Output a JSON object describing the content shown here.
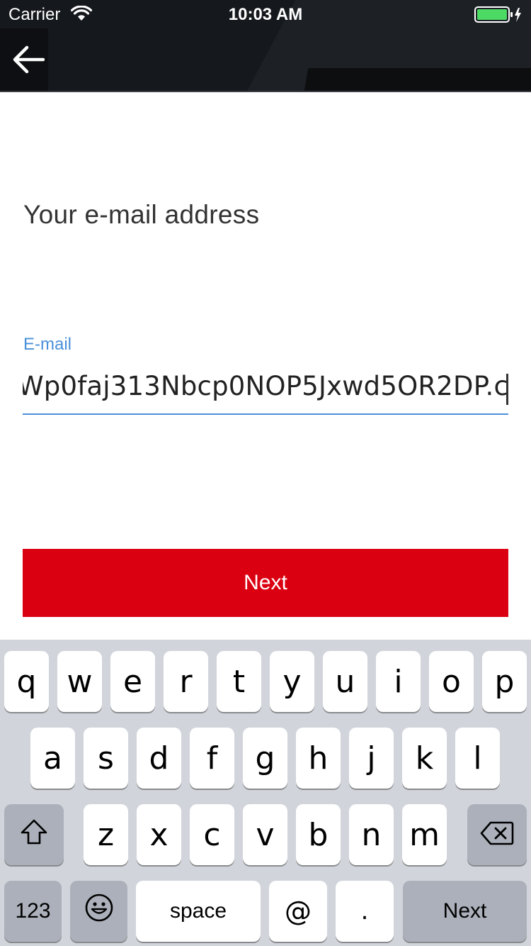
{
  "status_bar": {
    "carrier": "Carrier",
    "time": "10:03 AM",
    "battery_color": "#4cd964"
  },
  "header": {
    "back_icon": "arrow-left-icon"
  },
  "main": {
    "title": "Your e-mail address",
    "email_label": "E-mail",
    "email_value": "Wp0faj313Nbcp0NOP5Jxwd5OR2DP.c",
    "next_button": "Next",
    "accent_color": "#4a90d9",
    "button_color": "#db0011"
  },
  "keyboard": {
    "row1": [
      "q",
      "w",
      "e",
      "r",
      "t",
      "y",
      "u",
      "i",
      "o",
      "p"
    ],
    "row2": [
      "a",
      "s",
      "d",
      "f",
      "g",
      "h",
      "j",
      "k",
      "l"
    ],
    "row3": [
      "z",
      "x",
      "c",
      "v",
      "b",
      "n",
      "m"
    ],
    "shift_icon": "shift-icon",
    "delete_icon": "backspace-icon",
    "numbers_label": "123",
    "emoji_icon": "emoji-icon",
    "space_label": "space",
    "at_label": "@",
    "dot_label": ".",
    "return_label": "Next"
  }
}
